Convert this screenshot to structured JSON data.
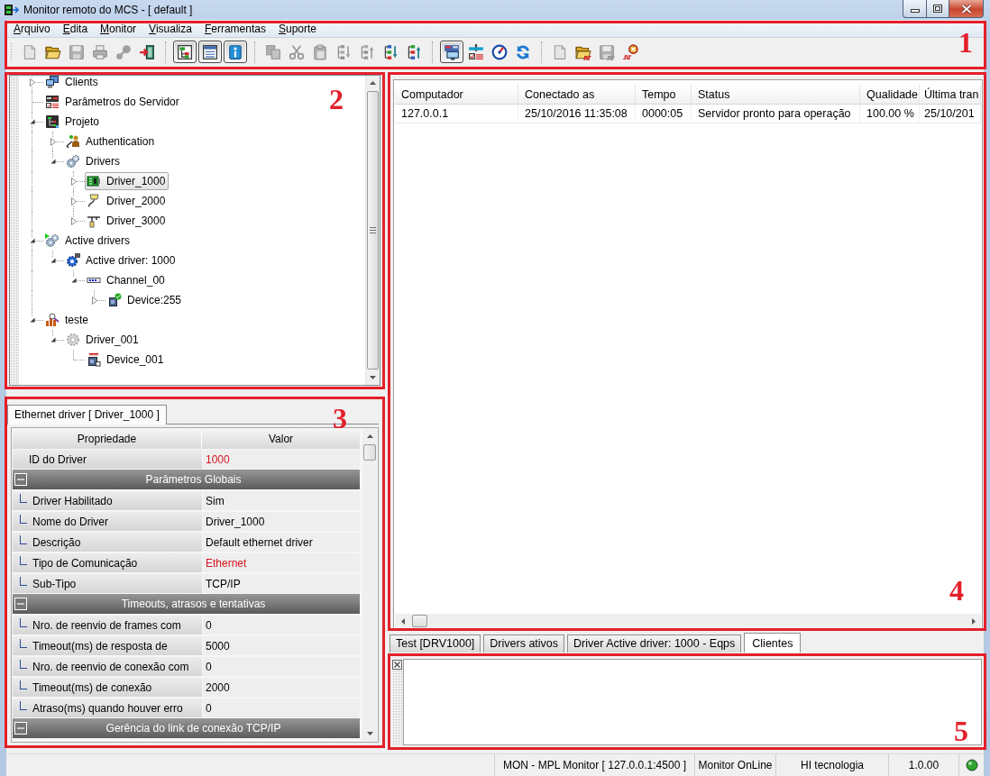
{
  "window": {
    "title": "Monitor remoto do MCS - [ default ]"
  },
  "menu": [
    "Arquivo",
    "Edita",
    "Monitor",
    "Visualiza",
    "Ferramentas",
    "Suporte"
  ],
  "toolbar": {
    "groups": [
      {
        "items": [
          {
            "kind": "new",
            "disabled": true,
            "pressed": false
          },
          {
            "kind": "open",
            "disabled": false,
            "pressed": false
          },
          {
            "kind": "save",
            "disabled": true,
            "pressed": false
          },
          {
            "kind": "print",
            "disabled": true,
            "pressed": false
          },
          {
            "kind": "connect",
            "disabled": true,
            "pressed": false
          },
          {
            "kind": "exit",
            "disabled": false,
            "pressed": false
          }
        ]
      },
      {
        "items": [
          {
            "kind": "tree_view",
            "disabled": false,
            "pressed": true
          },
          {
            "kind": "list_view",
            "disabled": false,
            "pressed": true
          },
          {
            "kind": "info",
            "disabled": false,
            "pressed": true
          }
        ]
      },
      {
        "items": [
          {
            "kind": "copy",
            "disabled": true,
            "pressed": false
          },
          {
            "kind": "cut",
            "disabled": true,
            "pressed": false
          },
          {
            "kind": "paste",
            "disabled": true,
            "pressed": false
          },
          {
            "kind": "move_up",
            "disabled": true,
            "pressed": false
          },
          {
            "kind": "move_down",
            "disabled": true,
            "pressed": false
          },
          {
            "kind": "import",
            "disabled": false,
            "pressed": false
          },
          {
            "kind": "export",
            "disabled": false,
            "pressed": false
          }
        ]
      },
      {
        "items": [
          {
            "kind": "monitor",
            "disabled": false,
            "pressed": true
          },
          {
            "kind": "parameters",
            "disabled": false,
            "pressed": false
          },
          {
            "kind": "gauge",
            "disabled": false,
            "pressed": false
          },
          {
            "kind": "refresh",
            "disabled": false,
            "pressed": false
          }
        ]
      },
      {
        "items": [
          {
            "kind": "new_log",
            "disabled": true,
            "pressed": false
          },
          {
            "kind": "open_log",
            "disabled": false,
            "pressed": false
          },
          {
            "kind": "save_log",
            "disabled": true,
            "pressed": false
          },
          {
            "kind": "stop_log",
            "disabled": false,
            "pressed": false
          }
        ]
      }
    ]
  },
  "tree": {
    "items": [
      {
        "label": "Clients",
        "kind": "clients",
        "expanded": false,
        "selected": false
      },
      {
        "label": "Parâmetros do Servidor",
        "kind": "server_parameters",
        "selected": false
      },
      {
        "label": "Projeto",
        "kind": "project",
        "expanded": true,
        "selected": false,
        "children": [
          {
            "label": "Authentication",
            "kind": "authentication",
            "expanded": false,
            "selected": false
          },
          {
            "label": "Drivers",
            "kind": "drivers",
            "expanded": true,
            "selected": false,
            "children": [
              {
                "label": "Driver_1000",
                "kind": "ethernet_driver",
                "expanded": false,
                "selected": true
              },
              {
                "label": "Driver_2000",
                "kind": "serial_driver",
                "expanded": false,
                "selected": false
              },
              {
                "label": "Driver_3000",
                "kind": "network_driver",
                "expanded": false,
                "selected": false
              }
            ]
          }
        ]
      },
      {
        "label": "Active drivers",
        "kind": "active_drivers",
        "expanded": true,
        "selected": false,
        "children": [
          {
            "label": "Active driver: 1000",
            "kind": "active_driver",
            "expanded": true,
            "selected": false,
            "children": [
              {
                "label": "Channel_00",
                "kind": "channel",
                "expanded": true,
                "selected": false,
                "children": [
                  {
                    "label": "Device:255",
                    "kind": "device_ok",
                    "expanded": false,
                    "selected": false
                  }
                ]
              }
            ]
          }
        ]
      },
      {
        "label": "teste",
        "kind": "test",
        "expanded": true,
        "selected": false,
        "children": [
          {
            "label": "Driver_001",
            "kind": "driver",
            "expanded": true,
            "selected": false,
            "children": [
              {
                "label": "Device_001",
                "kind": "device",
                "selected": false
              }
            ]
          }
        ]
      }
    ]
  },
  "properties": {
    "tabs": [
      {
        "label": "Ethernet driver [ Driver_1000 ]",
        "selected": true
      }
    ],
    "columns": [
      "Propriedade",
      "Valor"
    ],
    "rows": [
      {
        "kind": "property",
        "name": "ID do Driver",
        "value": "1000",
        "highlighted": true
      },
      {
        "kind": "section",
        "title": "Parâmetros Globais",
        "expanded": true,
        "children": [
          {
            "kind": "property",
            "name": "Driver Habilitado",
            "value": "Sim",
            "highlighted": false
          },
          {
            "kind": "property",
            "name": "Nome do Driver",
            "value": "Driver_1000",
            "highlighted": false
          },
          {
            "kind": "property",
            "name": "Descrição",
            "value": "Default ethernet driver",
            "highlighted": false
          },
          {
            "kind": "property",
            "name": "Tipo de Comunicação",
            "value": "Ethernet",
            "highlighted": true
          },
          {
            "kind": "property",
            "name": "Sub-Tipo",
            "value": "TCP/IP",
            "highlighted": false
          }
        ]
      },
      {
        "kind": "section",
        "title": "Timeouts, atrasos e tentativas",
        "expanded": true,
        "children": [
          {
            "kind": "property",
            "name": "Nro. de reenvio de frames com",
            "value": "0",
            "highlighted": false
          },
          {
            "kind": "property",
            "name": "Timeout(ms) de resposta de",
            "value": "5000",
            "highlighted": false
          },
          {
            "kind": "property",
            "name": "Nro. de reenvio de conexão com",
            "value": "0",
            "highlighted": false
          },
          {
            "kind": "property",
            "name": "Timeout(ms) de conexão",
            "value": "2000",
            "highlighted": false
          },
          {
            "kind": "property",
            "name": "Atraso(ms) quando houver erro",
            "value": "0",
            "highlighted": false
          }
        ]
      },
      {
        "kind": "section",
        "title": "Gerência do link de conexão TCP/IP",
        "expanded": true
      }
    ]
  },
  "clients_table": {
    "columns": [
      "Computador",
      "Conectado as",
      "Tempo",
      "Status",
      "Qualidade",
      "Última tran"
    ],
    "rows": [
      [
        "127.0.0.1",
        "25/10/2016 11:35:08",
        "0000:05",
        "Servidor pronto para operação",
        "100.00 %",
        "25/10/201"
      ]
    ]
  },
  "bottom_tabs": [
    {
      "label": "Test [DRV1000]",
      "selected": false
    },
    {
      "label": "Drivers ativos",
      "selected": false
    },
    {
      "label": "Driver Active driver: 1000 - Eqps",
      "selected": false
    },
    {
      "label": "Clientes",
      "selected": true
    }
  ],
  "status_bar": {
    "panels": [
      "MON - MPL Monitor [ 127.0.0.1:4500 ]",
      "Monitor OnLine",
      "HI tecnologia",
      "1.0.00"
    ],
    "connected": true
  },
  "annotations": [
    "1",
    "2",
    "3",
    "4",
    "5"
  ]
}
